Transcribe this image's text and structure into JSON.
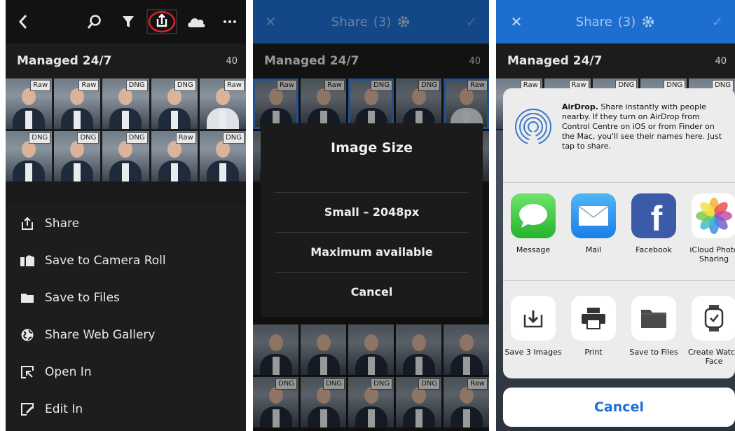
{
  "panel1": {
    "album_name": "Managed 24/7",
    "album_count": "40",
    "thumbs": [
      "Raw",
      "Raw",
      "DNG",
      "DNG",
      "Raw",
      "DNG",
      "DNG",
      "DNG",
      "Raw",
      "DNG"
    ],
    "menu": [
      "Share",
      "Save to Camera Roll",
      "Save to Files",
      "Share Web Gallery",
      "Open In",
      "Edit In"
    ],
    "icons": [
      "back-icon",
      "search-icon",
      "filter-icon",
      "share-icon",
      "cloud-icon",
      "more-icon"
    ],
    "highlight_color": "#e0202a"
  },
  "panel2": {
    "title": "Share",
    "count": "(3)",
    "album_name": "Managed 24/7",
    "album_count": "40",
    "top_thumbs": [
      "Raw",
      "Raw",
      "DNG",
      "DNG",
      "Raw"
    ],
    "bottom_thumbs": [
      "DNG",
      "DNG",
      "DNG",
      "DNG",
      "Raw"
    ],
    "dialog": {
      "title": "Image Size",
      "options": [
        "Small – 2048px",
        "Maximum available",
        "Cancel"
      ]
    }
  },
  "panel3": {
    "title": "Share",
    "count": "(3)",
    "album_name": "Managed 24/7",
    "album_count": "40",
    "top_thumbs": [
      "Raw",
      "Raw",
      "DNG",
      "DNG",
      "DNG"
    ],
    "airdrop_title": "AirDrop.",
    "airdrop_text": "Share instantly with people nearby. If they turn on AirDrop from Control Centre on iOS or from Finder on the Mac, you'll see their names here. Just tap to share.",
    "apps": [
      "Message",
      "Mail",
      "Facebook",
      "iCloud Photo Sharing"
    ],
    "actions": [
      "Save 3 Images",
      "Print",
      "Save to Files",
      "Create Watch Face"
    ],
    "cancel": "Cancel"
  },
  "colors": {
    "accent_blue": "#1e6ed0",
    "dark_bg": "#1a1a1a"
  }
}
